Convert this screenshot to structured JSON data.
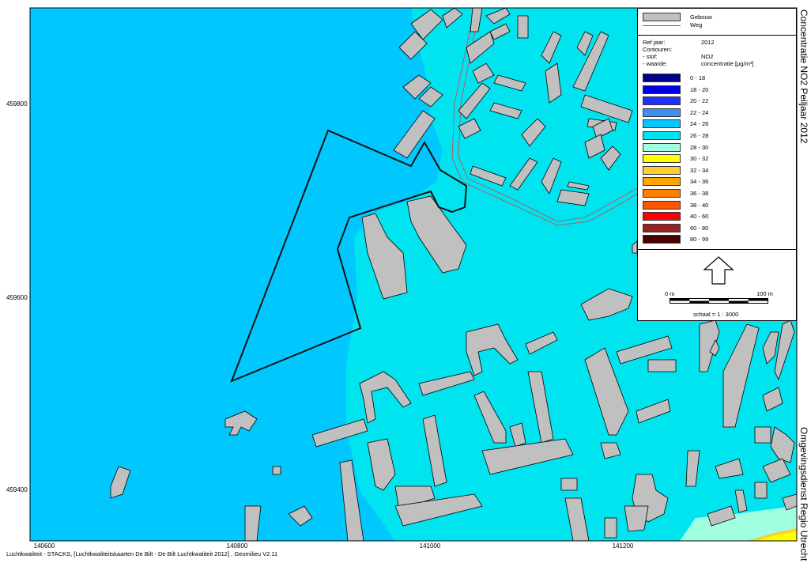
{
  "map": {
    "title_right": "Concentratie NO2 Peiljaar 2012",
    "org_right": "Omgevingsdienst Regio Utrecht",
    "footer": "Luchtkwaliteit - STACKS, [Luchtkwaliteitskaarten De Bilt - De Bilt Luchtkwaliteit 2012] , Geomilieu V2.11",
    "y_ticks": [
      "459800",
      "459600",
      "459400"
    ],
    "x_ticks": [
      "140600",
      "140800",
      "141000",
      "141200"
    ],
    "colors": {
      "zone_24_26": "#00c8ff",
      "zone_26_28": "#00e4f0",
      "zone_28_30": "#a0ffe0",
      "zone_30_32": "#ffff00",
      "zone_32_34": "#ffcc33",
      "building": "#c0c0c0",
      "road": "#cc4444"
    }
  },
  "legend": {
    "features": [
      {
        "label": "Gebouw",
        "type": "fill",
        "color": "#c0c0c0"
      },
      {
        "label": "Weg",
        "type": "line",
        "color": "#cc4444"
      }
    ],
    "meta": [
      {
        "key": "Ref jaar:",
        "value": "2012"
      },
      {
        "key": "Contouren:",
        "value": ""
      },
      {
        "key": "- stof:",
        "value": "NO2"
      },
      {
        "key": "- waarde:",
        "value": "concentratie [µg/m³]"
      }
    ],
    "classes": [
      {
        "label": "0 - 18",
        "color": "#00008b"
      },
      {
        "label": "18 - 20",
        "color": "#0000e6"
      },
      {
        "label": "20 - 22",
        "color": "#1f2fff"
      },
      {
        "label": "22 - 24",
        "color": "#3f8fef"
      },
      {
        "label": "24 - 26",
        "color": "#00c8ff"
      },
      {
        "label": "26 - 28",
        "color": "#00e4f0"
      },
      {
        "label": "28 - 30",
        "color": "#a0ffe0"
      },
      {
        "label": "30 - 32",
        "color": "#ffff00"
      },
      {
        "label": "32 - 34",
        "color": "#ffcc33"
      },
      {
        "label": "34 - 36",
        "color": "#ffa500"
      },
      {
        "label": "36 - 38",
        "color": "#ff7f00"
      },
      {
        "label": "38 - 40",
        "color": "#ff5500"
      },
      {
        "label": "40 - 60",
        "color": "#ff0000"
      },
      {
        "label": "60 - 80",
        "color": "#992222"
      },
      {
        "label": "80 - 99",
        "color": "#4a0000"
      }
    ],
    "scale": {
      "start_label": "0 m",
      "end_label": "100 m",
      "ratio_label": "schaal = 1 : 3000"
    },
    "north_icon": "north-arrow-icon"
  }
}
